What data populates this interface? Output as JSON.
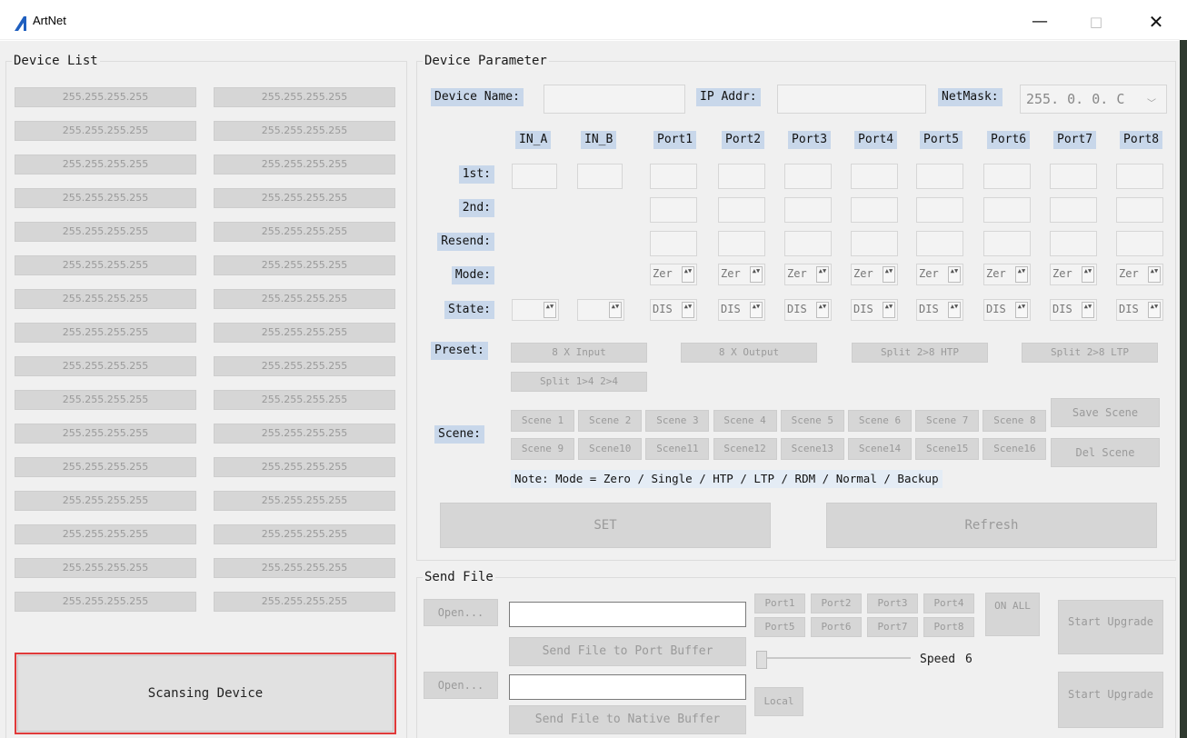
{
  "window": {
    "title": "ArtNet",
    "minimize": "—",
    "maximize": "□",
    "close": "✕"
  },
  "device_list": {
    "legend": "Device List",
    "left": [
      "255.255.255.255",
      "255.255.255.255",
      "255.255.255.255",
      "255.255.255.255",
      "255.255.255.255",
      "255.255.255.255",
      "255.255.255.255",
      "255.255.255.255",
      "255.255.255.255",
      "255.255.255.255",
      "255.255.255.255",
      "255.255.255.255",
      "255.255.255.255",
      "255.255.255.255",
      "255.255.255.255",
      "255.255.255.255"
    ],
    "right": [
      "255.255.255.255",
      "255.255.255.255",
      "255.255.255.255",
      "255.255.255.255",
      "255.255.255.255",
      "255.255.255.255",
      "255.255.255.255",
      "255.255.255.255",
      "255.255.255.255",
      "255.255.255.255",
      "255.255.255.255",
      "255.255.255.255",
      "255.255.255.255",
      "255.255.255.255",
      "255.255.255.255",
      "255.255.255.255"
    ],
    "scan_button": "Scansing Device"
  },
  "params": {
    "legend": "Device Parameter",
    "device_name_label": "Device Name:",
    "device_name_value": "",
    "ip_label": "IP Addr:",
    "ip_value": "",
    "netmask_label": "NetMask:",
    "netmask_value": "255.  0.  0.  C",
    "columns": [
      "IN_A",
      "IN_B",
      "Port1",
      "Port2",
      "Port3",
      "Port4",
      "Port5",
      "Port6",
      "Port7",
      "Port8"
    ],
    "rows": {
      "first": "1st:",
      "second": "2nd:",
      "resend": "Resend:",
      "mode": "Mode:",
      "state": "State:"
    },
    "mode_value": "Zer",
    "state_value": "DIS",
    "preset_label": "Preset:",
    "presets": [
      "8 X Input",
      "8 X Output",
      "Split 2>8 HTP",
      "Split 2>8 LTP",
      "Split 1>4 2>4"
    ],
    "scene_label": "Scene:",
    "scenes": [
      "Scene 1",
      "Scene 2",
      "Scene 3",
      "Scene 4",
      "Scene 5",
      "Scene 6",
      "Scene 7",
      "Scene 8",
      "Scene 9",
      "Scene10",
      "Scene11",
      "Scene12",
      "Scene13",
      "Scene14",
      "Scene15",
      "Scene16"
    ],
    "save_scene": "Save Scene",
    "del_scene": "Del Scene",
    "note": "Note: Mode = Zero / Single / HTP / LTP / RDM / Normal / Backup",
    "set_button": "SET",
    "refresh_button": "Refresh"
  },
  "send_file": {
    "legend": "Send File",
    "open1": "Open...",
    "open2": "Open...",
    "file1": "",
    "file2": "",
    "send_port_buffer": "Send File to Port Buffer",
    "send_native_buffer": "Send File to Native Buffer",
    "ports": [
      "Port1",
      "Port2",
      "Port3",
      "Port4",
      "Port5",
      "Port6",
      "Port7",
      "Port8"
    ],
    "on_all": "ON ALL",
    "speed_label": "Speed",
    "speed_value": "6",
    "local": "Local",
    "start_upgrade_1": "Start Upgrade",
    "start_upgrade_2": "Start Upgrade"
  }
}
